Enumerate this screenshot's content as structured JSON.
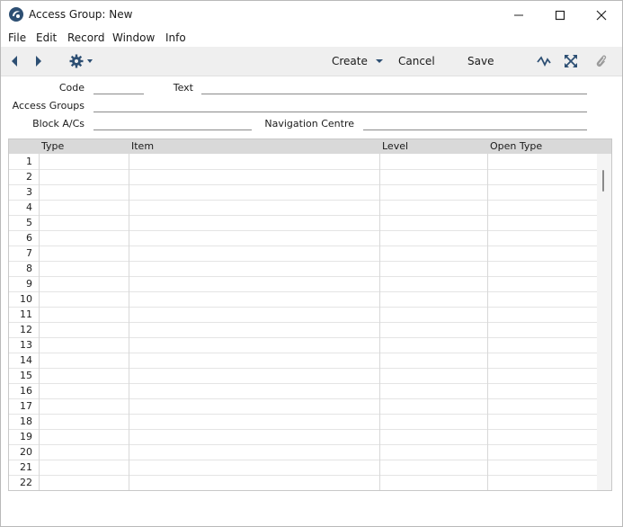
{
  "window": {
    "title": "Access Group: New"
  },
  "menubar": {
    "items": [
      "File",
      "Edit",
      "Record",
      "Window",
      "Info"
    ]
  },
  "toolbar": {
    "create_label": "Create",
    "cancel_label": "Cancel",
    "save_label": "Save"
  },
  "form": {
    "code_label": "Code",
    "code_value": "",
    "text_label": "Text",
    "text_value": "",
    "access_groups_label": "Access Groups",
    "access_groups_value": "",
    "block_acs_label": "Block A/Cs",
    "block_acs_value": "",
    "navigation_centre_label": "Navigation Centre",
    "navigation_centre_value": ""
  },
  "grid": {
    "columns": [
      "Type",
      "Item",
      "Level",
      "Open Type"
    ],
    "row_numbers": [
      "1",
      "2",
      "3",
      "4",
      "5",
      "6",
      "7",
      "8",
      "9",
      "10",
      "11",
      "12",
      "13",
      "14",
      "15",
      "16",
      "17",
      "18",
      "19",
      "20",
      "21",
      "22"
    ]
  }
}
